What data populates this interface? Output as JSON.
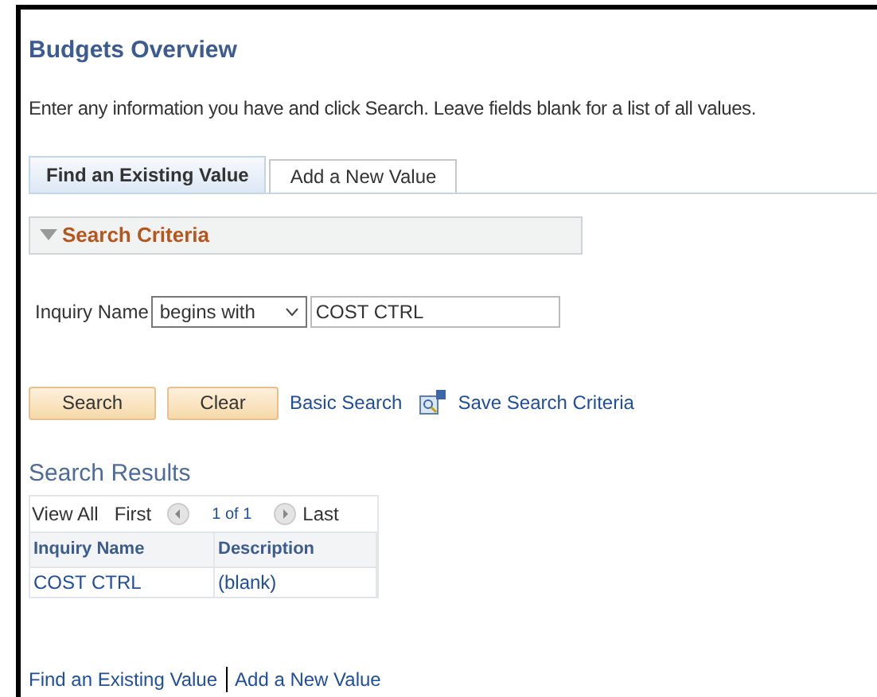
{
  "page": {
    "title": "Budgets Overview",
    "instructions": "Enter any information you have and click Search. Leave fields blank for a list of all values."
  },
  "tabs": [
    {
      "label": "Find an Existing Value",
      "selected": true
    },
    {
      "label": "Add a New Value",
      "selected": false
    }
  ],
  "search_criteria": {
    "title": "Search Criteria",
    "expanded": true,
    "field_label": "Inquiry Name",
    "operator": "begins with",
    "value": "COST CTRL"
  },
  "actions": {
    "search": "Search",
    "clear": "Clear",
    "basic_search": "Basic Search",
    "save_criteria": "Save Search Criteria"
  },
  "results": {
    "title": "Search Results",
    "view_all": "View All",
    "first": "First",
    "page": "1 of 1",
    "last": "Last",
    "columns": [
      "Inquiry Name",
      "Description"
    ],
    "rows": [
      [
        "COST CTRL",
        "(blank)"
      ]
    ]
  },
  "footer_links": [
    "Find an Existing Value",
    "Add a New Value"
  ]
}
